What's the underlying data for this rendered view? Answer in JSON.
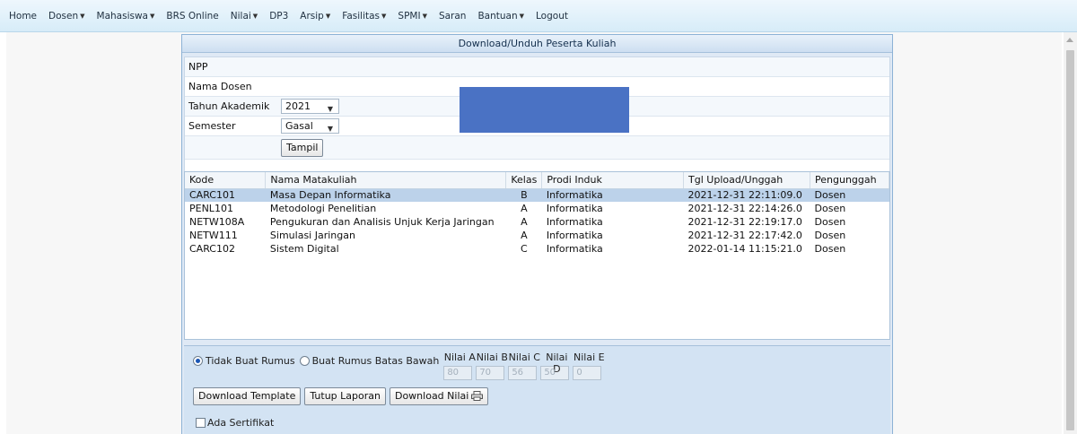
{
  "menu": {
    "items": [
      {
        "label": "Home",
        "dropdown": false
      },
      {
        "label": "Dosen",
        "dropdown": true
      },
      {
        "label": "Mahasiswa",
        "dropdown": true
      },
      {
        "label": "BRS Online",
        "dropdown": false
      },
      {
        "label": "Nilai",
        "dropdown": true
      },
      {
        "label": "DP3",
        "dropdown": false
      },
      {
        "label": "Arsip",
        "dropdown": true
      },
      {
        "label": "Fasilitas",
        "dropdown": true
      },
      {
        "label": "SPMI",
        "dropdown": true
      },
      {
        "label": "Saran",
        "dropdown": false
      },
      {
        "label": "Bantuan",
        "dropdown": true
      },
      {
        "label": "Logout",
        "dropdown": false
      }
    ]
  },
  "panel": {
    "title": "Download/Unduh Peserta Kuliah"
  },
  "form": {
    "npp_label": "NPP",
    "nama_label": "Nama Dosen",
    "tahun_label": "Tahun Akademik",
    "tahun_value": "2021",
    "semester_label": "Semester",
    "semester_value": "Gasal",
    "tampil_label": "Tampil"
  },
  "table": {
    "headers": [
      "Kode",
      "Nama Matakuliah",
      "Kelas",
      "Prodi Induk",
      "Tgl Upload/Unggah",
      "Pengunggah"
    ],
    "rows": [
      {
        "kode": "CARC101",
        "nama": "Masa Depan Informatika",
        "kelas": "B",
        "prodi": "Informatika",
        "tgl": "2021-12-31 22:11:09.0",
        "pengunggah": "Dosen",
        "selected": true
      },
      {
        "kode": "PENL101",
        "nama": "Metodologi Penelitian",
        "kelas": "A",
        "prodi": "Informatika",
        "tgl": "2021-12-31 22:14:26.0",
        "pengunggah": "Dosen",
        "selected": false
      },
      {
        "kode": "NETW108A",
        "nama": "Pengukuran dan Analisis Unjuk Kerja Jaringan",
        "kelas": "A",
        "prodi": "Informatika",
        "tgl": "2021-12-31 22:19:17.0",
        "pengunggah": "Dosen",
        "selected": false
      },
      {
        "kode": "NETW111",
        "nama": "Simulasi Jaringan",
        "kelas": "A",
        "prodi": "Informatika",
        "tgl": "2021-12-31 22:17:42.0",
        "pengunggah": "Dosen",
        "selected": false
      },
      {
        "kode": "CARC102",
        "nama": "Sistem Digital",
        "kelas": "C",
        "prodi": "Informatika",
        "tgl": "2022-01-14 11:15:21.0",
        "pengunggah": "Dosen",
        "selected": false
      }
    ]
  },
  "options": {
    "radio_tidak": "Tidak Buat Rumus",
    "radio_buat": "Buat Rumus Batas Bawah",
    "selected_radio": "tidak",
    "nilai": [
      {
        "label": "Nilai A",
        "value": "80"
      },
      {
        "label": "Nilai B",
        "value": "70"
      },
      {
        "label": "Nilai C",
        "value": "56"
      },
      {
        "label": "Nilai D",
        "value": "50"
      },
      {
        "label": "Nilai E",
        "value": "0"
      }
    ],
    "download_template": "Download Template",
    "tutup_laporan": "Tutup Laporan",
    "download_nilai": "Download Nilai",
    "sertifikat_label": "Ada Sertifikat",
    "sertifikat_checked": false
  },
  "colors": {
    "redaction": "#4a72c4",
    "selected_row": "#bcd2ea"
  }
}
